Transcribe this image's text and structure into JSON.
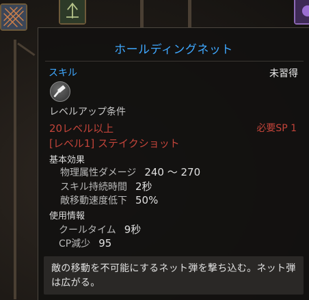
{
  "tooltip": {
    "title": "ホールディングネット",
    "skill_type": "スキル",
    "learn_status": "未習得",
    "requirements": {
      "heading": "レベルアップ条件",
      "level": "20レベル以上",
      "sp": "必要SP 1",
      "prerequisite": "[レベル1] ステイクショット"
    },
    "effects": {
      "heading": "基本効果",
      "items": [
        {
          "label": "物理属性ダメージ",
          "value": "240 ～ 270"
        },
        {
          "label": "スキル持続時間",
          "value": "2秒"
        },
        {
          "label": "敵移動速度低下",
          "value": "50%"
        }
      ]
    },
    "usage": {
      "heading": "使用情報",
      "items": [
        {
          "label": "クールタイム",
          "value": "9秒"
        },
        {
          "label": "CP減少",
          "value": "95"
        }
      ]
    },
    "description": "敵の移動を不可能にするネット弾を撃ち込む。ネット弾は広がる。"
  },
  "colors": {
    "title": "#3fa8ff",
    "requirement_unmet": "#c3443a",
    "background": "#1c1814"
  },
  "icons": {
    "skill": "hammer-icon",
    "tree_slot_1": "net-skill-icon",
    "tree_slot_2": "arrow-skill-icon",
    "tree_slot_3": "purple-skill-icon"
  }
}
